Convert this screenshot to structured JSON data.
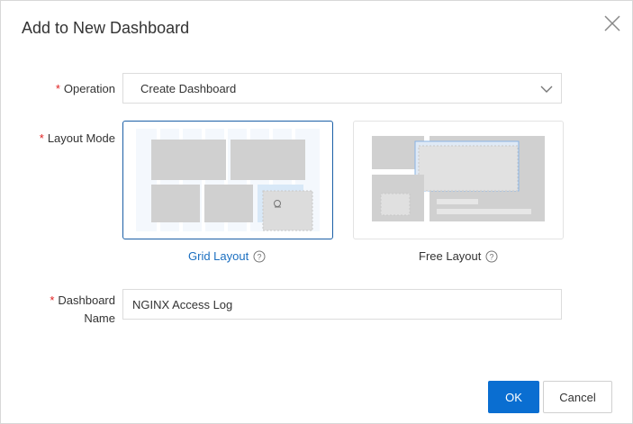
{
  "dialog": {
    "title": "Add to New Dashboard"
  },
  "form": {
    "required_mark": "*",
    "operation": {
      "label": "Operation",
      "value": "Create Dashboard"
    },
    "layout_mode": {
      "label": "Layout Mode",
      "options": [
        {
          "label": "Grid Layout",
          "selected": true
        },
        {
          "label": "Free Layout",
          "selected": false
        }
      ]
    },
    "dashboard_name": {
      "label_line1": "Dashboard",
      "label_line2": "Name",
      "value": "NGINX Access Log"
    }
  },
  "buttons": {
    "ok": "OK",
    "cancel": "Cancel"
  },
  "colors": {
    "primary": "#0a6ed1",
    "selected_border": "#1b5fa6",
    "selected_text": "#1b6fc0",
    "required": "#e02020"
  },
  "icons": {
    "close": "close-icon",
    "dropdown": "chevron-down-icon",
    "help": "question-circle-icon",
    "drag": "hand-cursor-icon"
  }
}
